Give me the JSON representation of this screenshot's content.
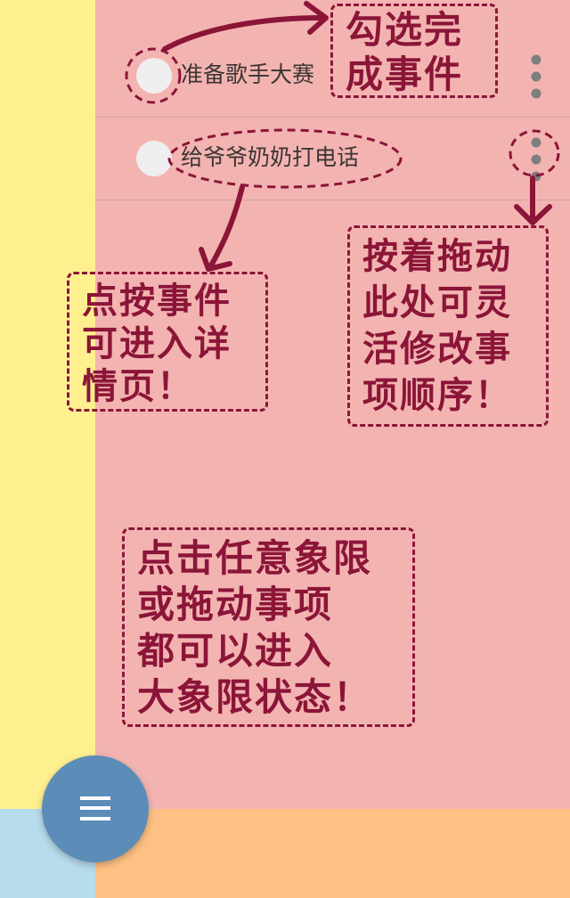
{
  "colors": {
    "quadrant_top_left": "#fff08f",
    "quadrant_top_right": "#f3b4b1",
    "quadrant_bottom_left": "#b7dcec",
    "quadrant_bottom_right": "#ffc083",
    "checkbox": "#efefef",
    "fab": "#5b8db8",
    "annotation": "#8b1538",
    "task_text": "#3c3434",
    "handle": "#7e7e7e"
  },
  "tasks": [
    {
      "title": "准备歌手大赛",
      "checkbox_icon": "circle-checkbox-icon",
      "handle_icon": "drag-handle-dots-icon"
    },
    {
      "title": "给爷爷奶奶打电话",
      "checkbox_icon": "circle-checkbox-icon",
      "handle_icon": "drag-handle-dots-icon"
    }
  ],
  "annotations": {
    "complete": "勾选完\n成事件",
    "open_detail": "点按事件\n可进入详\n情页！",
    "reorder": "按着拖动\n此处可灵\n活修改事\n项顺序！",
    "big_quadrant": "点击任意象限\n或拖动事项\n都可以进入\n大象限状态！"
  },
  "fab": {
    "icon": "menu-icon"
  }
}
